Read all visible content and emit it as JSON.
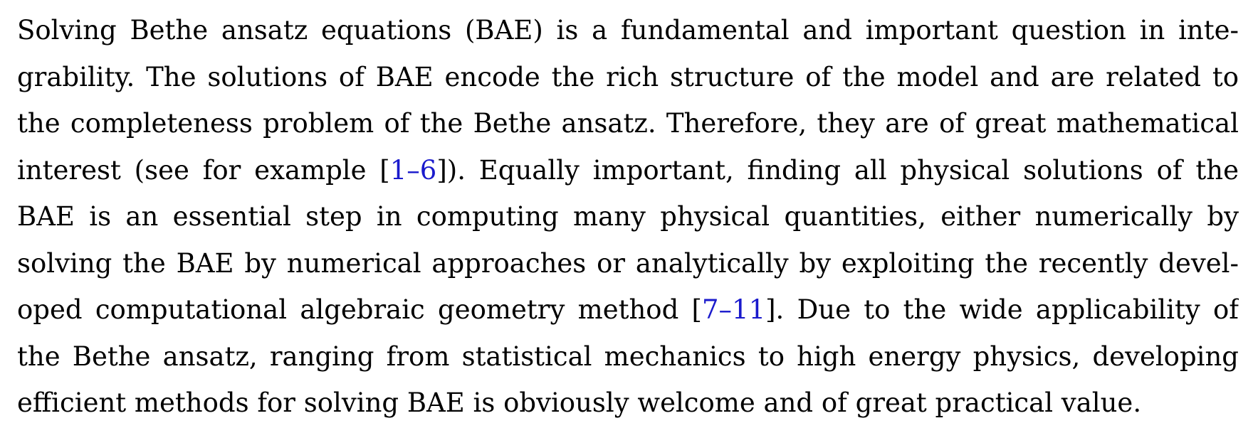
{
  "paragraph": {
    "lines": [
      "Solving Bethe ansatz equations (BAE) is a fundamental and important question in inte-",
      "grability. The solutions of BAE encode the rich structure of the model and are related to",
      "the completeness problem of the Bethe ansatz. Therefore, they are of great mathematical",
      {
        "before": "interest (see for example [",
        "cite": "1–6",
        "after": "]). Equally important, finding all physical solutions of the"
      },
      "BAE is an essential step in computing many physical quantities, either numerically by",
      "solving the BAE by numerical approaches or analytically by exploiting the recently devel-",
      {
        "before": "oped computational algebraic geometry method [",
        "cite": "7–11",
        "after": "]. Due to the wide applicability of"
      },
      "the Bethe ansatz, ranging from statistical mechanics to high energy physics, developing",
      "efficient methods for solving BAE is obviously welcome and of great practical value."
    ]
  },
  "colors": {
    "text": "#000000",
    "citation_link": "#1a1acc"
  }
}
